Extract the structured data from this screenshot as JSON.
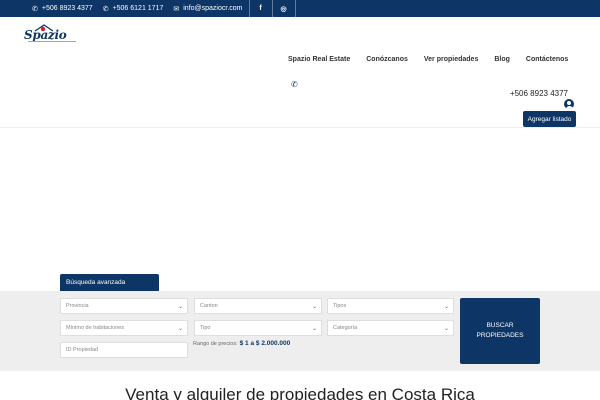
{
  "topbar": {
    "phone1": "+506 8923 4377",
    "phone2": "+506 6121 1717",
    "email": "info@spaziocr.com",
    "facebook": "f",
    "instagram": "◎"
  },
  "logo": {
    "text": "Spazio"
  },
  "nav": {
    "items": [
      "Spazio Real Estate",
      "Conózcanos",
      "Ver propiedades",
      "Blog",
      "Contáctenos"
    ]
  },
  "header": {
    "phone": "+506 8923 4377",
    "add_listing": "Agregar listado"
  },
  "search": {
    "tab_label": "Búsqueda avanzada",
    "provincia": "Provincia",
    "canton": "Canton",
    "tipos": "Tipos",
    "min_habitaciones": "Mínimo de habitaciones",
    "tipo": "Tipo",
    "categoria": "Categoría",
    "id_propiedad": "ID Propiedad",
    "price_label": "Rango de precios:",
    "price_range": "$ 1 a $ 2.000.000",
    "button": "BUSCAR PROPIEDADES"
  },
  "main": {
    "title": "Venta y alquiler de propiedades en Costa Rica"
  },
  "colors": {
    "brand": "#0d3566",
    "logo_accent": "#d0202e"
  }
}
